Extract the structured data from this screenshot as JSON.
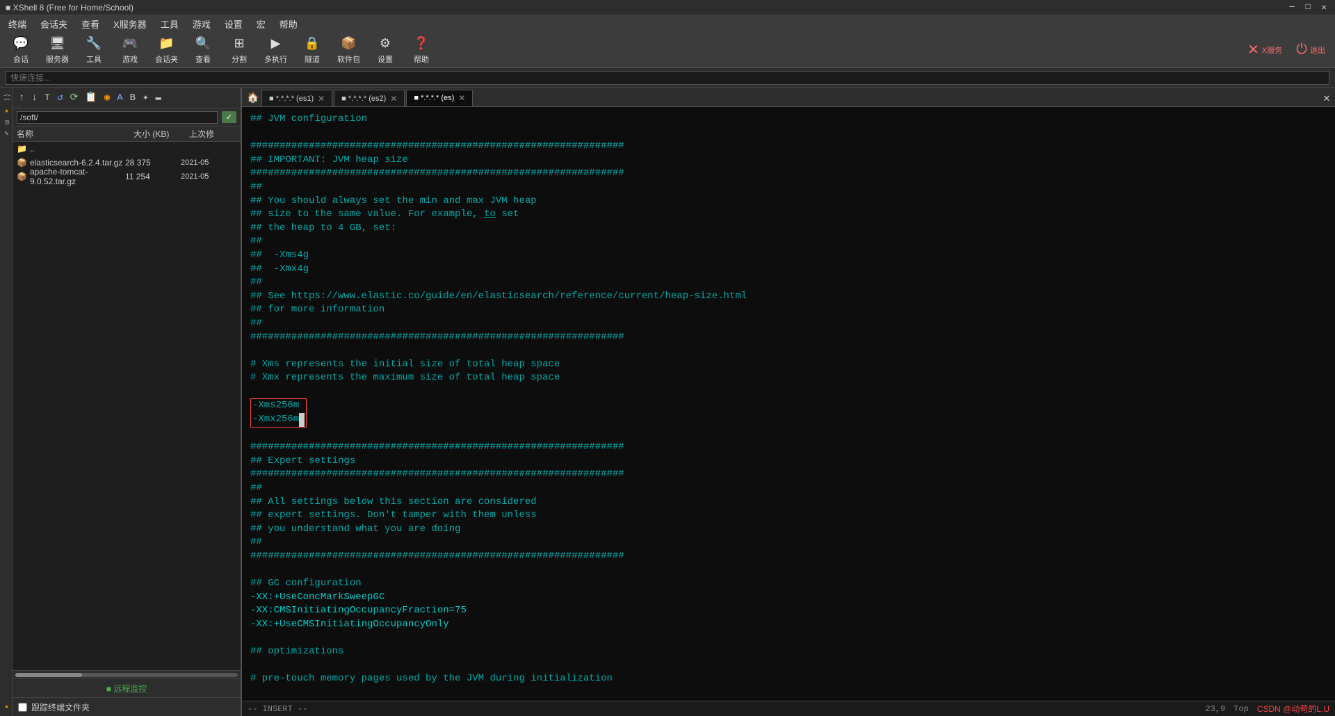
{
  "window": {
    "title": "■ XShell 8 (Free for Home/School)",
    "controls": {
      "minimize": "─",
      "maximize": "□",
      "close": "✕"
    }
  },
  "menubar": {
    "items": [
      "终端",
      "会话夹",
      "查看",
      "X服务器",
      "工具",
      "游戏",
      "设置",
      "宏",
      "帮助"
    ]
  },
  "toolbar": {
    "buttons": [
      {
        "label": "会话",
        "icon": "💬"
      },
      {
        "label": "服务器",
        "icon": "🖥"
      },
      {
        "label": "工具",
        "icon": "🔧"
      },
      {
        "label": "游戏",
        "icon": "🎮"
      },
      {
        "label": "会话夹",
        "icon": "📁"
      },
      {
        "label": "查看",
        "icon": "🔍"
      },
      {
        "label": "分割",
        "icon": "⊞"
      },
      {
        "label": "多执行",
        "icon": "▶"
      },
      {
        "label": "隧道",
        "icon": "🔒"
      },
      {
        "label": "软件包",
        "icon": "📦"
      },
      {
        "label": "设置",
        "icon": "⚙"
      },
      {
        "label": "帮助",
        "icon": "❓"
      }
    ]
  },
  "quick_connect": {
    "placeholder": "快速连接..."
  },
  "file_panel": {
    "path": "/soft/",
    "columns": {
      "name": "名称",
      "size": "大小 (KB)",
      "date": "上次修"
    },
    "files": [
      {
        "icon": "📄",
        "name": "..",
        "size": "",
        "date": ""
      },
      {
        "icon": "📦",
        "name": "elasticsearch-6.2.4.tar.gz",
        "size": "28 375",
        "date": "2021-05"
      },
      {
        "icon": "📦",
        "name": "apache-tomcat-9.0.52.tar.gz",
        "size": "11 254",
        "date": "2021-05"
      }
    ],
    "remote_monitor_label": "■ 远程监控",
    "track_label": "跟踪终端文件夹"
  },
  "tabs": [
    {
      "label": "■ *.*.*.* (es1)",
      "active": false
    },
    {
      "label": "■ *.*.*.* (es2)",
      "active": false
    },
    {
      "label": "■ *.*.*.* (es)",
      "active": true
    }
  ],
  "terminal": {
    "lines": [
      {
        "text": "## JVM configuration",
        "type": "comment"
      },
      {
        "text": "",
        "type": "blank"
      },
      {
        "text": "################################################################",
        "type": "comment"
      },
      {
        "text": "## IMPORTANT: JVM heap size",
        "type": "comment"
      },
      {
        "text": "################################################################",
        "type": "comment"
      },
      {
        "text": "##",
        "type": "comment"
      },
      {
        "text": "## You should always set the min and max JVM heap",
        "type": "comment"
      },
      {
        "text": "## size to the same value. For example, to set",
        "type": "comment"
      },
      {
        "text": "## the heap to 4 GB, set:",
        "type": "comment"
      },
      {
        "text": "##",
        "type": "comment"
      },
      {
        "text": "##  -Xms4g",
        "type": "comment"
      },
      {
        "text": "##  -Xmx4g",
        "type": "comment"
      },
      {
        "text": "##",
        "type": "comment"
      },
      {
        "text": "## See https://www.elastic.co/guide/en/elasticsearch/reference/current/heap-size.html",
        "type": "comment"
      },
      {
        "text": "## for more information",
        "type": "comment"
      },
      {
        "text": "##",
        "type": "comment"
      },
      {
        "text": "################################################################",
        "type": "comment"
      },
      {
        "text": "",
        "type": "blank"
      },
      {
        "text": "# Xms represents the initial size of total heap space",
        "type": "comment"
      },
      {
        "text": "# Xmx represents the maximum size of total heap space",
        "type": "comment"
      },
      {
        "text": "",
        "type": "blank"
      },
      {
        "text": "-Xms256m",
        "type": "selected"
      },
      {
        "text": "-Xmx256m",
        "type": "selected"
      },
      {
        "text": "",
        "type": "blank"
      },
      {
        "text": "################################################################",
        "type": "comment"
      },
      {
        "text": "## Expert settings",
        "type": "comment"
      },
      {
        "text": "################################################################",
        "type": "comment"
      },
      {
        "text": "##",
        "type": "comment"
      },
      {
        "text": "## All settings below this section are considered",
        "type": "comment"
      },
      {
        "text": "## expert settings. Don't tamper with them unless",
        "type": "comment"
      },
      {
        "text": "## you understand what you are doing",
        "type": "comment"
      },
      {
        "text": "##",
        "type": "comment"
      },
      {
        "text": "################################################################",
        "type": "comment"
      },
      {
        "text": "",
        "type": "blank"
      },
      {
        "text": "## GC configuration",
        "type": "comment"
      },
      {
        "text": "-XX:+UseConcMarkSweepGC",
        "type": "normal"
      },
      {
        "text": "-XX:CMSInitiatingOccupancyFraction=75",
        "type": "normal"
      },
      {
        "text": "-XX:+UseCMSInitiatingOccupancyOnly",
        "type": "normal"
      },
      {
        "text": "",
        "type": "blank"
      },
      {
        "text": "## optimizations",
        "type": "comment"
      },
      {
        "text": "",
        "type": "blank"
      },
      {
        "text": "# pre-touch memory pages used by the JVM during initialization",
        "type": "comment"
      }
    ],
    "status_text": "-- INSERT --",
    "position": "23,9",
    "position_label": "Top"
  },
  "right_panel": {
    "x_service_label": "X服务",
    "exit_label": "退出",
    "csdn_text": "CSDN @动苟的L.U"
  }
}
